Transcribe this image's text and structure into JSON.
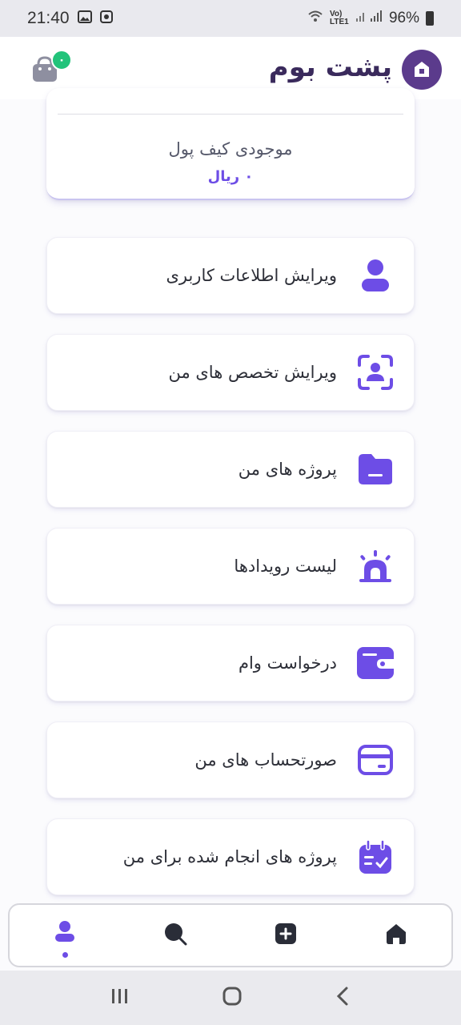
{
  "status_bar": {
    "time": "21:40",
    "network": "Vo) LTE1",
    "battery": "96%"
  },
  "header": {
    "app_name": "پشت بوم",
    "cart_count": "۰"
  },
  "wallet": {
    "label": "موجودی کیف پول",
    "amount": "۰ ریال"
  },
  "menu": {
    "items": [
      {
        "label": "ویرایش اطلاعات کاربری",
        "icon": "user-icon"
      },
      {
        "label": "ویرایش تخصص های من",
        "icon": "user-scan-icon"
      },
      {
        "label": "پروژه های من",
        "icon": "folder-icon"
      },
      {
        "label": "لیست رویدادها",
        "icon": "siren-icon"
      },
      {
        "label": "درخواست وام",
        "icon": "wallet-icon"
      },
      {
        "label": "صورتحساب های من",
        "icon": "card-icon"
      },
      {
        "label": "پروژه های انجام شده برای من",
        "icon": "calendar-check-icon"
      }
    ]
  },
  "bottom_nav": {
    "items": [
      "home-icon",
      "add-icon",
      "search-icon",
      "profile-icon"
    ],
    "active": "profile-icon"
  },
  "colors": {
    "accent": "#6d4de6",
    "brand": "#5b3b8c",
    "badge": "#22c37a"
  }
}
